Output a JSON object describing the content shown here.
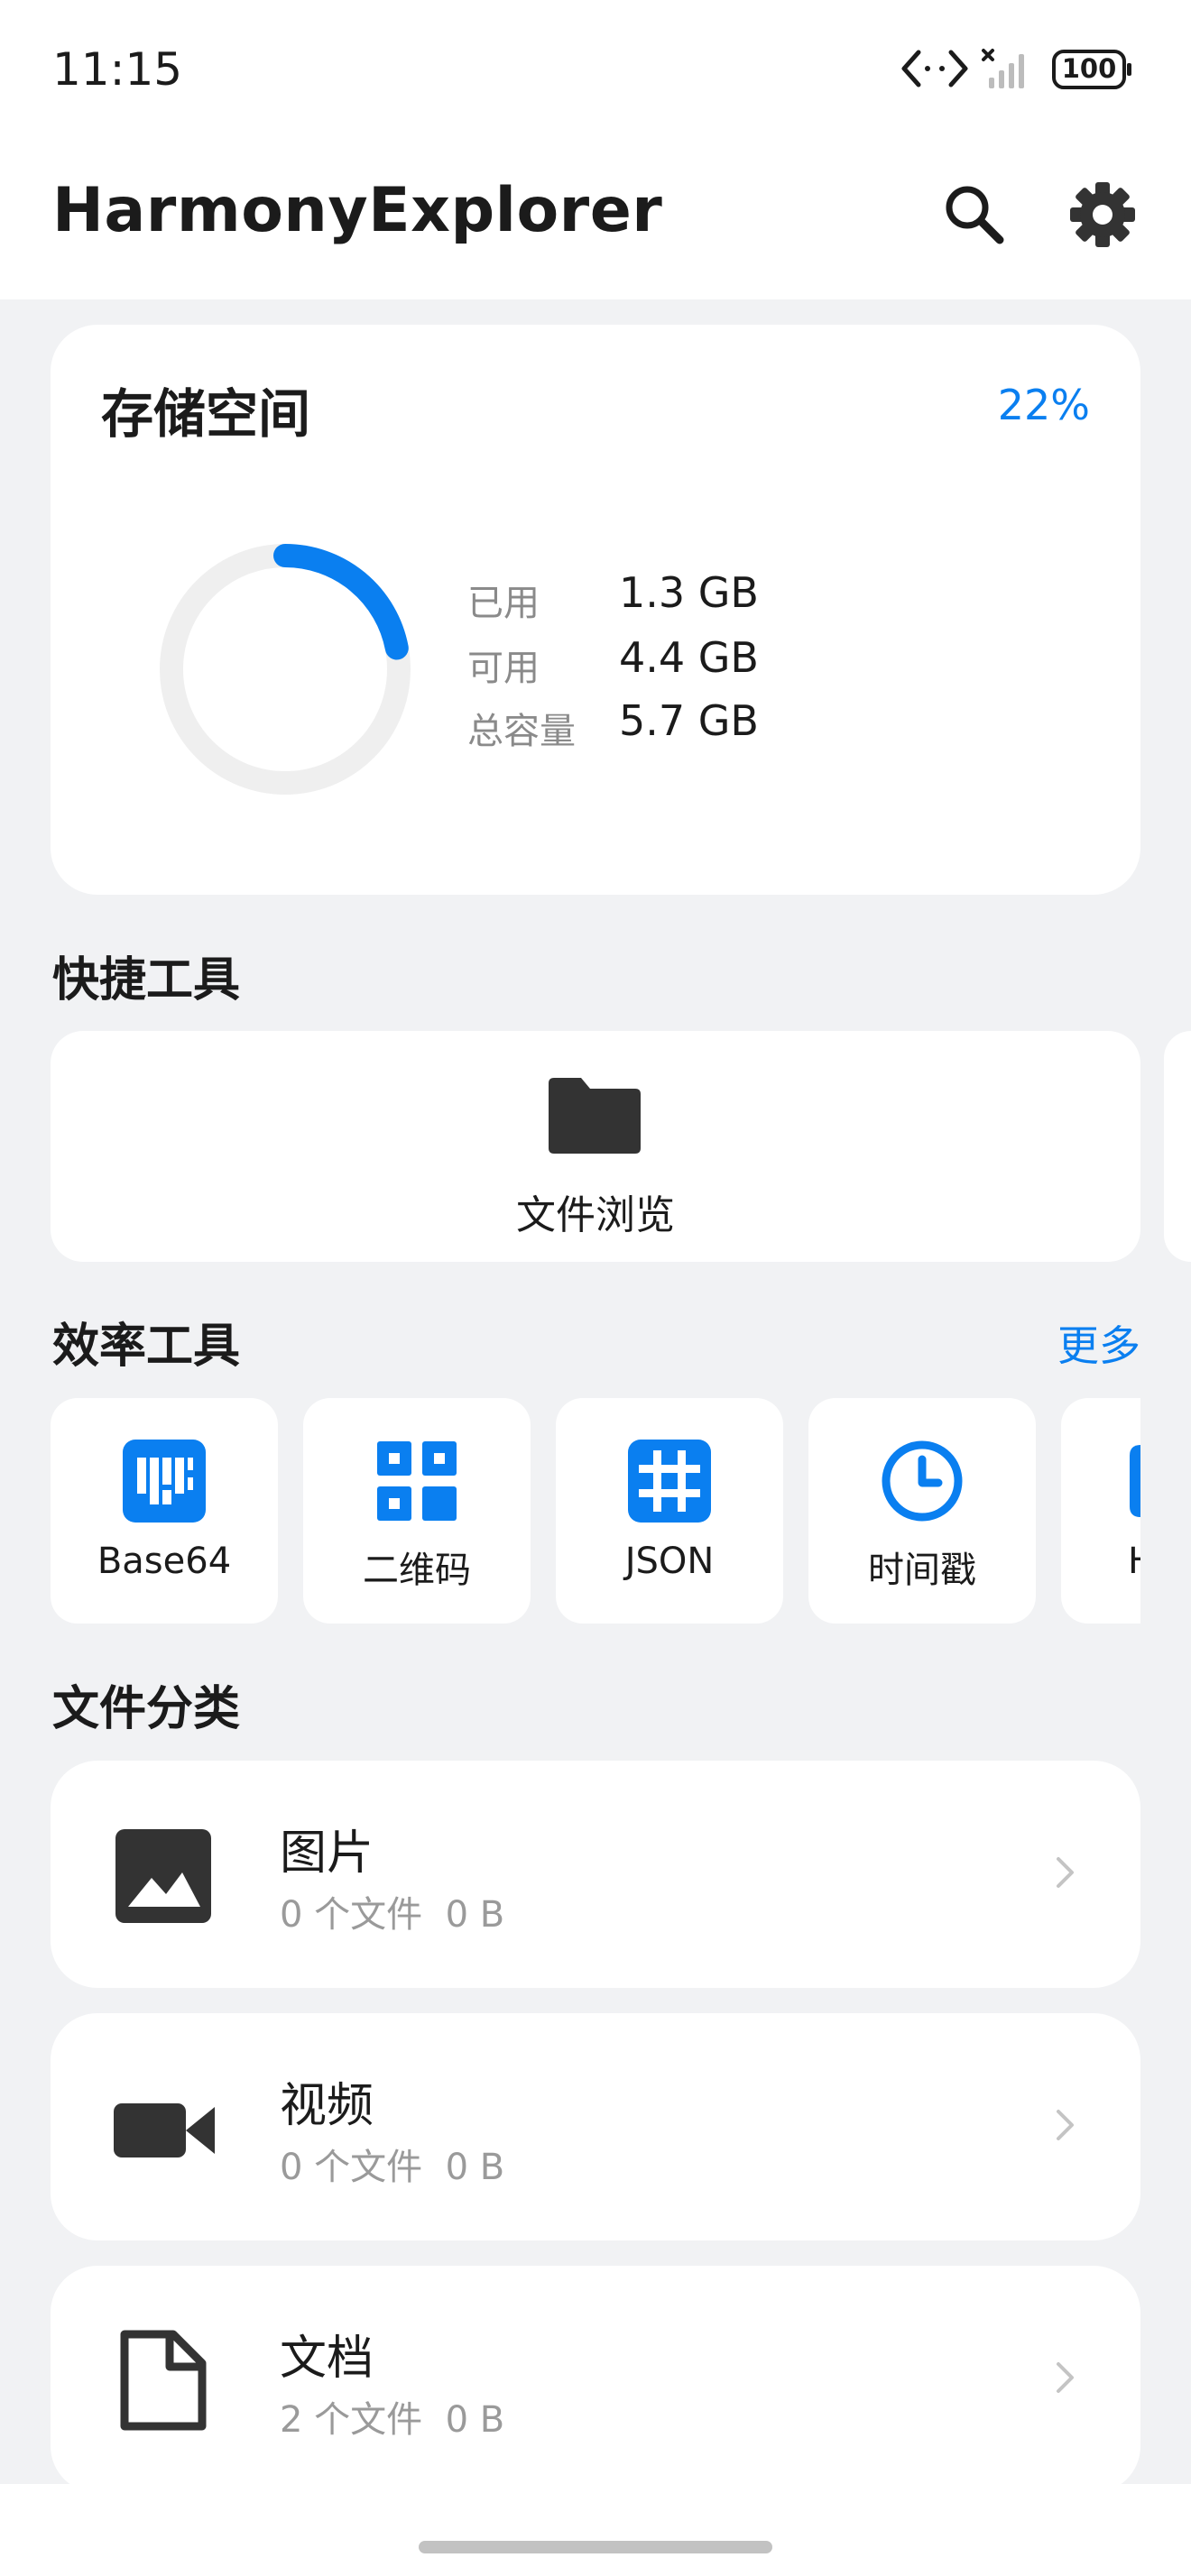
{
  "status_bar": {
    "time": "11:15",
    "battery": "100",
    "icons": [
      "data-transfer-icon",
      "signal-no-service-icon",
      "battery-icon"
    ]
  },
  "app": {
    "title": "HarmonyExplorer",
    "actions": [
      "search-icon",
      "settings-gear-icon"
    ]
  },
  "storage": {
    "title": "存储空间",
    "percent_label": "22%",
    "used_fraction": 0.22,
    "stats": [
      {
        "label": "已用",
        "value": "1.3 GB"
      },
      {
        "label": "可用",
        "value": "4.4 GB"
      },
      {
        "label": "总容量",
        "value": "5.7 GB"
      }
    ]
  },
  "quick_tools": {
    "title": "快捷工具",
    "items": [
      {
        "label": "文件浏览",
        "icon": "folder-icon"
      }
    ]
  },
  "efficiency_tools": {
    "title": "效率工具",
    "more": "更多",
    "items": [
      {
        "label": "Base64",
        "icon": "base64-icon"
      },
      {
        "label": "二维码",
        "icon": "qr-code-icon"
      },
      {
        "label": "JSON",
        "icon": "json-grid-icon"
      },
      {
        "label": "时间戳",
        "icon": "clock-icon"
      },
      {
        "label": "H",
        "icon": "partial-tool-icon"
      }
    ]
  },
  "file_categories": {
    "title": "文件分类",
    "items": [
      {
        "name": "图片",
        "count": "0 个文件",
        "size": "0 B",
        "icon": "image-icon"
      },
      {
        "name": "视频",
        "count": "0 个文件",
        "size": "0 B",
        "icon": "video-camera-icon"
      },
      {
        "name": "文档",
        "count": "2 个文件",
        "size": "0 B",
        "icon": "document-icon"
      }
    ]
  },
  "colors": {
    "accent": "#0a7ff0",
    "background": "#f1f2f4",
    "card": "#ffffff",
    "ring_track": "#efefef",
    "icon_dark": "#333333",
    "muted_text": "#9a9a9a"
  }
}
